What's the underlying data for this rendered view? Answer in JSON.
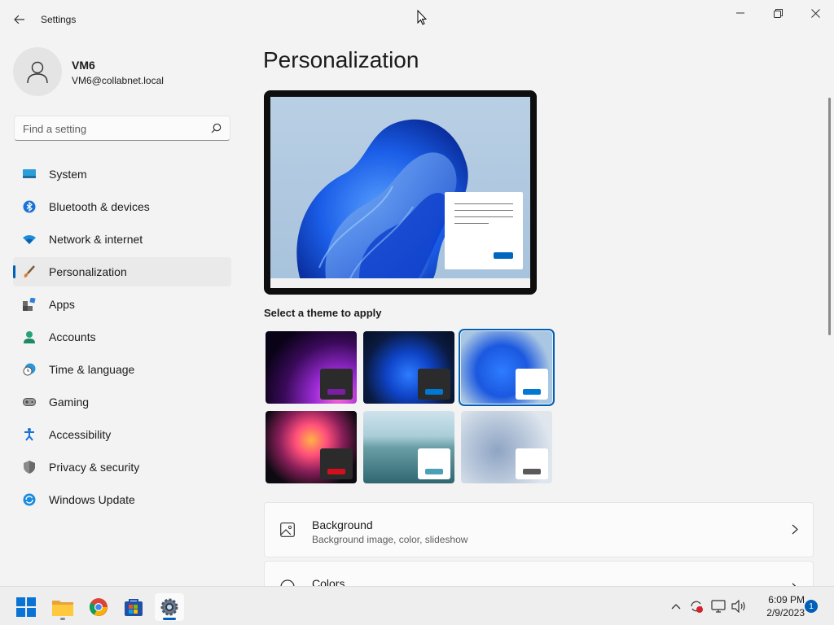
{
  "window": {
    "title": "Settings"
  },
  "user": {
    "name": "VM6",
    "email": "VM6@collabnet.local"
  },
  "search": {
    "placeholder": "Find a setting"
  },
  "sidebar": {
    "items": [
      {
        "label": "System",
        "icon": "system-icon"
      },
      {
        "label": "Bluetooth & devices",
        "icon": "bluetooth-icon"
      },
      {
        "label": "Network & internet",
        "icon": "wifi-icon"
      },
      {
        "label": "Personalization",
        "icon": "brush-icon",
        "active": true
      },
      {
        "label": "Apps",
        "icon": "apps-icon"
      },
      {
        "label": "Accounts",
        "icon": "person-icon"
      },
      {
        "label": "Time & language",
        "icon": "clock-globe-icon"
      },
      {
        "label": "Gaming",
        "icon": "gamepad-icon"
      },
      {
        "label": "Accessibility",
        "icon": "accessibility-icon"
      },
      {
        "label": "Privacy & security",
        "icon": "shield-icon"
      },
      {
        "label": "Windows Update",
        "icon": "update-icon"
      }
    ]
  },
  "main": {
    "title": "Personalization",
    "themes_label": "Select a theme to apply",
    "themes": [
      {
        "name": "glow-dark",
        "accent": "#7a1fa2",
        "selected": false
      },
      {
        "name": "bloom-dark",
        "accent": "#0078d4",
        "selected": false
      },
      {
        "name": "bloom-light",
        "accent": "#0078d4",
        "selected": true
      },
      {
        "name": "captured-motion",
        "accent": "#d1101e",
        "selected": false
      },
      {
        "name": "lake",
        "accent": "#4aa0b5",
        "selected": false
      },
      {
        "name": "flow",
        "accent": "#5a5a5a",
        "selected": false
      }
    ],
    "cards": [
      {
        "title": "Background",
        "subtitle": "Background image, color, slideshow",
        "icon": "image-icon"
      },
      {
        "title": "Colors",
        "subtitle": "",
        "icon": "palette-icon"
      }
    ]
  },
  "taskbar": {
    "apps": [
      "start-icon",
      "file-explorer-icon",
      "chrome-icon",
      "store-icon",
      "settings-icon"
    ],
    "time": "6:09 PM",
    "date": "2/9/2023",
    "notifications": "1"
  },
  "colors": {
    "accent": "#005fb8",
    "background": "#f3f3f3"
  }
}
